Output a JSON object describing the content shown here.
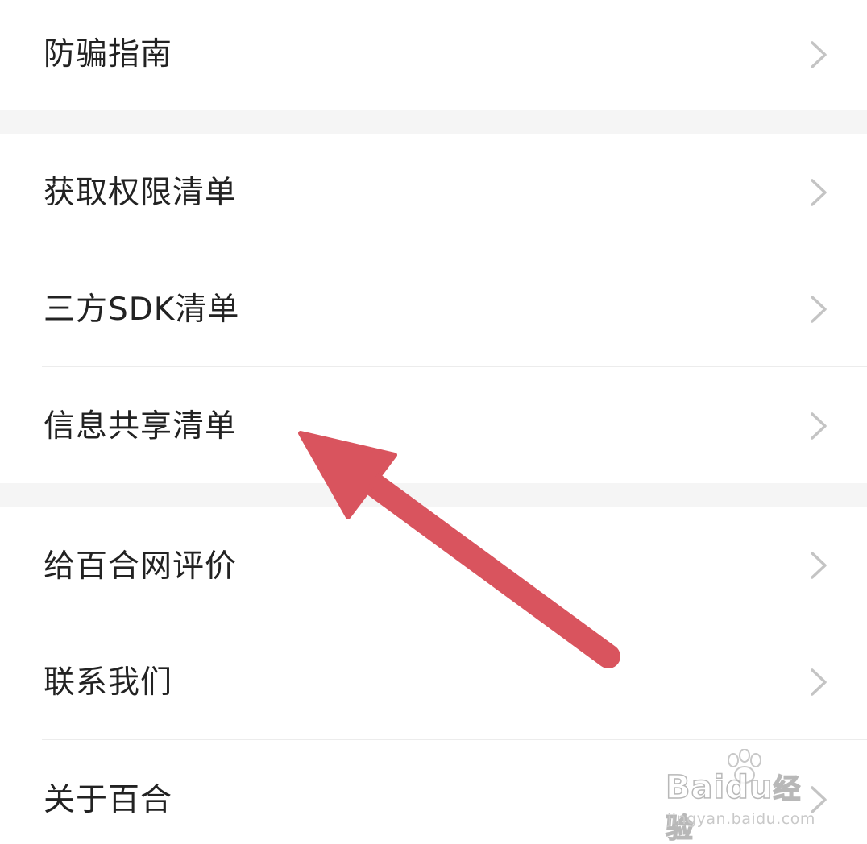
{
  "menu": {
    "items": [
      {
        "label": "防骗指南"
      },
      {
        "label": "获取权限清单"
      },
      {
        "label": "三方SDK清单"
      },
      {
        "label": "信息共享清单"
      },
      {
        "label": "给百合网评价"
      },
      {
        "label": "联系我们"
      },
      {
        "label": "关于百合"
      }
    ]
  },
  "annotation": {
    "arrow_color": "#d9545e",
    "points_to": "信息共享清单"
  },
  "watermark": {
    "brand": "Bai",
    "brand_suffix": "du",
    "product": "经验",
    "url": "jingyan.baidu.com"
  },
  "colors": {
    "background": "#ffffff",
    "section_gap": "#f5f5f5",
    "text": "#222222",
    "chevron": "#c4c4c4",
    "divider": "#ececec"
  }
}
